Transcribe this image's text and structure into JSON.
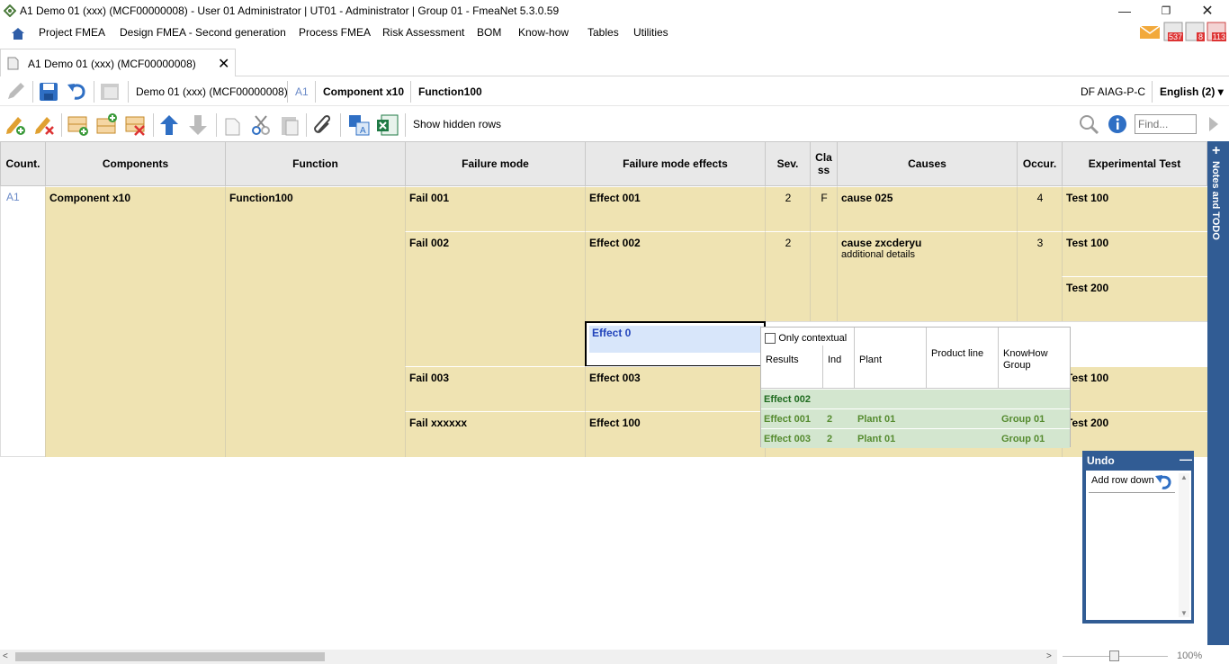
{
  "window": {
    "title": "A1 Demo 01 (xxx) (MCF00000008) - User 01 Administrator | UT01 - Administrator | Group 01 - FmeaNet 5.3.0.59"
  },
  "menu": {
    "items": [
      "Project FMEA",
      "Design FMEA - Second generation",
      "Process FMEA",
      "Risk Assessment",
      "BOM",
      "Know-how",
      "Tables",
      "Utilities"
    ]
  },
  "notifications": {
    "mail": "",
    "badge1": "537",
    "badge2": "8",
    "badge3": "113"
  },
  "tab": {
    "label": "A1 Demo 01 (xxx) (MCF00000008)"
  },
  "toolbar1": {
    "doc": "Demo 01 (xxx) (MCF00000008)",
    "code": "A1",
    "component": "Component x10",
    "function": "Function100",
    "standard": "DF AIAG-P-C",
    "language": "English (2)",
    "lang_caret": "▾"
  },
  "toolbar2": {
    "show_hidden": "Show hidden rows",
    "find_placeholder": "Find..."
  },
  "grid": {
    "headers": [
      "Count.",
      "Components",
      "Function",
      "Failure mode",
      "Failure mode effects",
      "Sev.",
      "Cla ss",
      "Causes",
      "Occur.",
      "Experimental Test"
    ],
    "count": "A1",
    "component": "Component x10",
    "function": "Function100",
    "rows": [
      {
        "failure": "Fail 001",
        "effect": "Effect 001",
        "sev": "2",
        "class": "F",
        "cause": "cause 025",
        "cause_sub": "",
        "occ": "4",
        "test": "Test 100"
      },
      {
        "failure": "Fail 002",
        "effect": "Effect 002",
        "sev": "2",
        "class": "",
        "cause": "cause zxcderyu",
        "cause_sub": "additional details",
        "occ": "3",
        "test": "Test 100",
        "test2": "Test 200"
      },
      {
        "failure": "Fail 003",
        "effect": "Effect 003",
        "test": "Test 100"
      },
      {
        "failure": "Fail xxxxxx",
        "effect": "Effect 100",
        "test": "Test 200"
      }
    ],
    "edit_value": "Effect 0"
  },
  "popup": {
    "only_contextual": "Only contextual",
    "headers": [
      "Results",
      "Ind",
      "Plant",
      "Product line",
      "KnowHow Group"
    ],
    "rows": [
      {
        "result": "Effect 002",
        "ind": "",
        "plant": "",
        "line": "",
        "group": ""
      },
      {
        "result": "Effect 001",
        "ind": "2",
        "plant": "Plant 01",
        "line": "",
        "group": "Group 01"
      },
      {
        "result": "Effect 003",
        "ind": "2",
        "plant": "Plant 01",
        "line": "",
        "group": "Group 01"
      }
    ]
  },
  "notes": {
    "label": "Notes and TODO",
    "plus": "+"
  },
  "undo": {
    "title": "Undo",
    "item": "Add row down"
  },
  "zoom": {
    "value": "100%"
  }
}
